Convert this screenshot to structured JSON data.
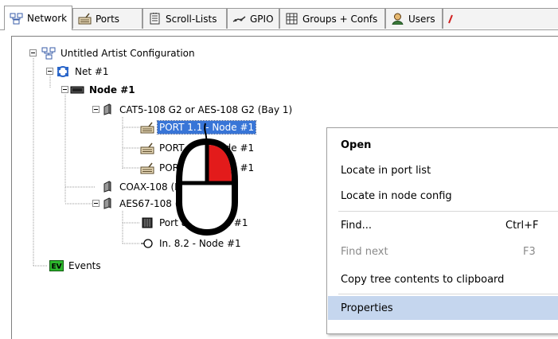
{
  "tabs": [
    {
      "label": "Network",
      "icon": "network-icon",
      "active": true
    },
    {
      "label": "Ports",
      "icon": "ports-icon",
      "active": false
    },
    {
      "label": "Scroll-Lists",
      "icon": "scroll-list-icon",
      "active": false
    },
    {
      "label": "GPIO",
      "icon": "gpio-icon",
      "active": false
    },
    {
      "label": "Groups + Confs",
      "icon": "groups-icon",
      "active": false
    },
    {
      "label": "Users",
      "icon": "users-icon",
      "active": false
    }
  ],
  "tree": {
    "root": {
      "label": "Untitled Artist Configuration",
      "icon": "network-icon"
    },
    "net": {
      "label": "Net #1",
      "icon": "net-icon"
    },
    "node": {
      "label": "Node #1",
      "icon": "node-icon"
    },
    "card1": {
      "label": "CAT5-108 G2 or AES-108 G2 (Bay  1)",
      "icon": "card-icon"
    },
    "port1": {
      "label": "PORT 1.1 - Node #1",
      "icon": "port-icon",
      "selected": true
    },
    "port2": {
      "label": "PORT 1.2 - Node #1",
      "icon": "port-icon"
    },
    "port3": {
      "label": "PORT 1.3 - Node #1",
      "icon": "port-icon"
    },
    "card2": {
      "label": "COAX-108 (Bay  2)",
      "icon": "card-icon"
    },
    "card3": {
      "label": "AES67-108 (Bay  8)",
      "icon": "card-icon"
    },
    "port4": {
      "label": "Port 8.1 - Node #1",
      "icon": "speaker-icon"
    },
    "port5": {
      "label": "In. 8.2 - Node #1",
      "icon": "input-icon"
    },
    "events": {
      "label": "Events",
      "icon": "events-icon",
      "badge": "EV"
    }
  },
  "context_menu": {
    "items": [
      {
        "label": "Open",
        "shortcut": "",
        "bold": true,
        "disabled": false
      },
      {
        "label": "Locate in port list",
        "shortcut": "",
        "bold": false,
        "disabled": false
      },
      {
        "label": "Locate in node config",
        "shortcut": "",
        "bold": false,
        "disabled": false
      },
      {
        "label": "Find...",
        "shortcut": "Ctrl+F",
        "bold": false,
        "disabled": false
      },
      {
        "label": "Find next",
        "shortcut": "F3",
        "bold": false,
        "disabled": true
      },
      {
        "label": "Copy tree contents to clipboard",
        "shortcut": "",
        "bold": false,
        "disabled": false
      },
      {
        "label": "Properties",
        "shortcut": "",
        "bold": false,
        "disabled": false,
        "highlighted": true
      }
    ]
  },
  "overlay": {
    "icon": "mouse-right-click-icon",
    "highlight_color": "#e31b1b"
  },
  "colors": {
    "selection": "#3875d7",
    "menu_highlight": "#c5d6ee",
    "events_badge": "#2db82d"
  }
}
